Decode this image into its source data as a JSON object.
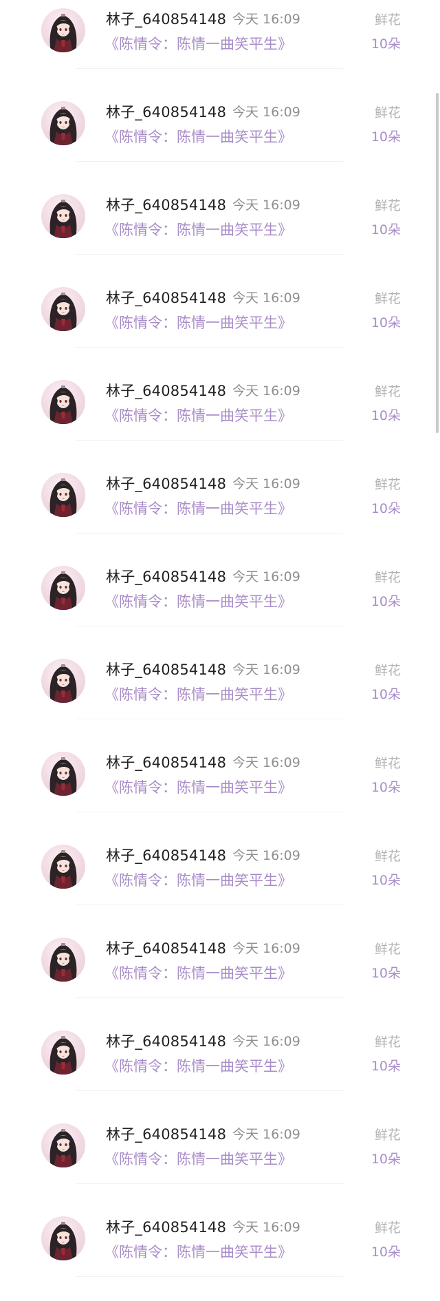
{
  "records": [
    {
      "username": "林子_640854148",
      "time": "今天 16:09",
      "book": "《陈情令：陈情一曲笑平生》",
      "gift_type": "鲜花",
      "gift_count": "10朵"
    },
    {
      "username": "林子_640854148",
      "time": "今天 16:09",
      "book": "《陈情令：陈情一曲笑平生》",
      "gift_type": "鲜花",
      "gift_count": "10朵"
    },
    {
      "username": "林子_640854148",
      "time": "今天 16:09",
      "book": "《陈情令：陈情一曲笑平生》",
      "gift_type": "鲜花",
      "gift_count": "10朵"
    },
    {
      "username": "林子_640854148",
      "time": "今天 16:09",
      "book": "《陈情令：陈情一曲笑平生》",
      "gift_type": "鲜花",
      "gift_count": "10朵"
    },
    {
      "username": "林子_640854148",
      "time": "今天 16:09",
      "book": "《陈情令：陈情一曲笑平生》",
      "gift_type": "鲜花",
      "gift_count": "10朵"
    },
    {
      "username": "林子_640854148",
      "time": "今天 16:09",
      "book": "《陈情令：陈情一曲笑平生》",
      "gift_type": "鲜花",
      "gift_count": "10朵"
    },
    {
      "username": "林子_640854148",
      "time": "今天 16:09",
      "book": "《陈情令：陈情一曲笑平生》",
      "gift_type": "鲜花",
      "gift_count": "10朵"
    },
    {
      "username": "林子_640854148",
      "time": "今天 16:09",
      "book": "《陈情令：陈情一曲笑平生》",
      "gift_type": "鲜花",
      "gift_count": "10朵"
    },
    {
      "username": "林子_640854148",
      "time": "今天 16:09",
      "book": "《陈情令：陈情一曲笑平生》",
      "gift_type": "鲜花",
      "gift_count": "10朵"
    },
    {
      "username": "林子_640854148",
      "time": "今天 16:09",
      "book": "《陈情令：陈情一曲笑平生》",
      "gift_type": "鲜花",
      "gift_count": "10朵"
    },
    {
      "username": "林子_640854148",
      "time": "今天 16:09",
      "book": "《陈情令：陈情一曲笑平生》",
      "gift_type": "鲜花",
      "gift_count": "10朵"
    },
    {
      "username": "林子_640854148",
      "time": "今天 16:09",
      "book": "《陈情令：陈情一曲笑平生》",
      "gift_type": "鲜花",
      "gift_count": "10朵"
    },
    {
      "username": "林子_640854148",
      "time": "今天 16:09",
      "book": "《陈情令：陈情一曲笑平生》",
      "gift_type": "鲜花",
      "gift_count": "10朵"
    },
    {
      "username": "林子_640854148",
      "time": "今天 16:09",
      "book": "《陈情令：陈情一曲笑平生》",
      "gift_type": "鲜花",
      "gift_count": "10朵"
    }
  ],
  "colors": {
    "username": "#222222",
    "time": "#8f8f8f",
    "book": "#a98dc9",
    "gift_type": "#b3b3b3",
    "gift_count": "#a98dc9"
  },
  "icons": {
    "avatar": "anime-character-avatar"
  }
}
